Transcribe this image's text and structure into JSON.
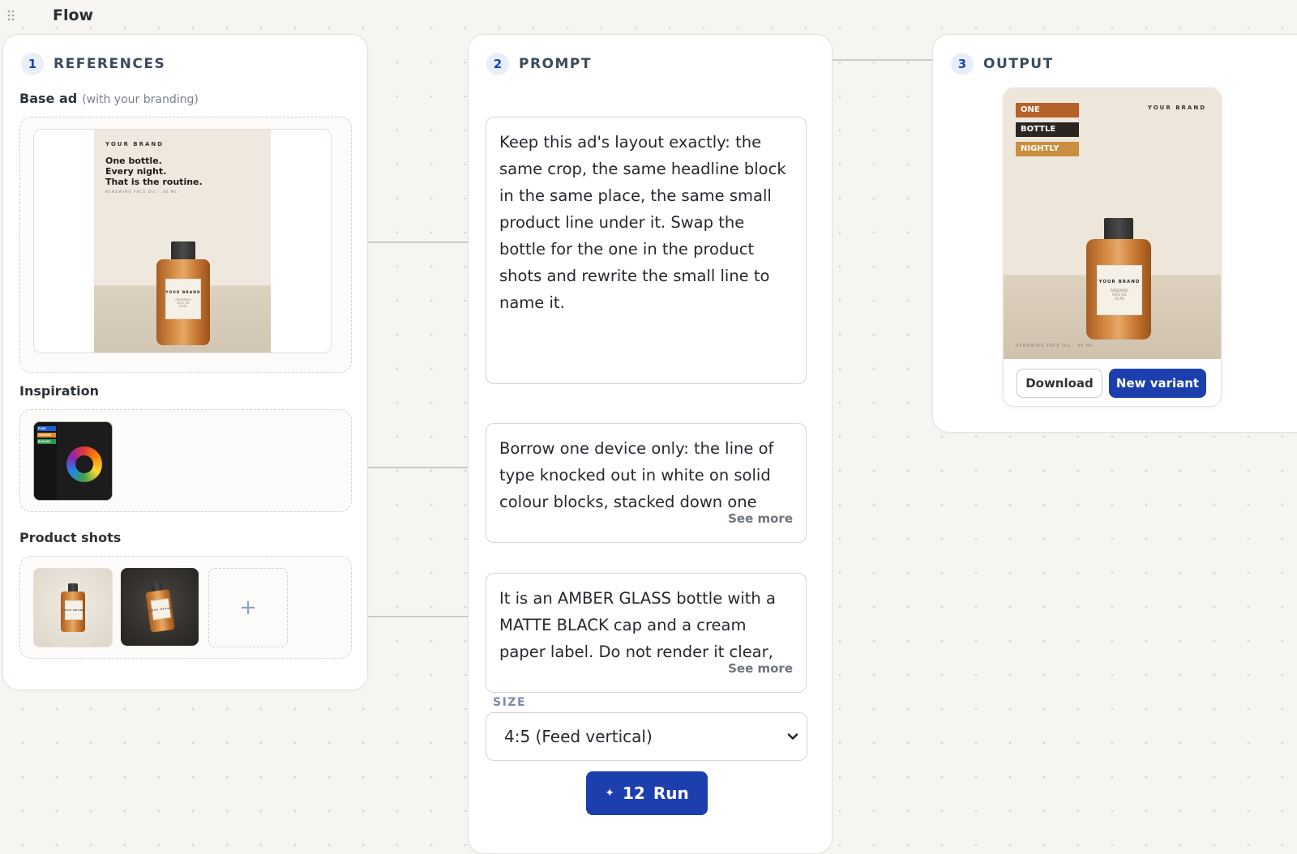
{
  "app": {
    "title": "Flow"
  },
  "references": {
    "step": "1",
    "title": "REFERENCES",
    "base_ad_label": "Base ad",
    "base_ad_hint": "(with your branding)",
    "base_ad": {
      "brand": "YOUR BRAND",
      "headline": [
        "One bottle.",
        "Every night.",
        "That is the routine."
      ],
      "subline": "RENEWING FACE OIL · 30 ML",
      "bottle_label": {
        "brand": "YOUR BRAND",
        "lines": [
          "RENEWING",
          "FACE OIL",
          "30 ML"
        ]
      }
    },
    "inspiration_label": "Inspiration",
    "inspiration_tags": [
      {
        "text": "PLAY",
        "color": "#1e5fd8"
      },
      {
        "text": "COLOUR",
        "color": "#e08a1e"
      },
      {
        "text": "BLOCKS",
        "color": "#2e9a4a"
      }
    ],
    "product_shots_label": "Product shots",
    "product_shot_label": {
      "brand": "YOUR BRAND",
      "lines": [
        "RENEWING",
        "FACE OIL"
      ]
    },
    "add_symbol": "+"
  },
  "prompt": {
    "step": "2",
    "title": "PROMPT",
    "blocks": [
      {
        "text": "Keep this ad's layout exactly: the same crop, the same headline block in the same place, the same small product line under it. Swap the bottle for the one in the product shots and rewrite the small line to name it."
      },
      {
        "text": "Borrow one device only: the line of type knocked out in white on solid colour blocks, stacked down one",
        "more": "See more"
      },
      {
        "text": "It is an AMBER GLASS bottle with a MATTE BLACK cap and a cream paper label. Do not render it clear,",
        "more": "See more"
      }
    ],
    "size_label": "SIZE",
    "size_value": "4:5 (Feed vertical)",
    "run_count": "12",
    "run_label": "Run"
  },
  "output": {
    "step": "3",
    "title": "OUTPUT",
    "ad": {
      "brand": "YOUR BRAND",
      "blocks": [
        {
          "text": "ONE",
          "color": "#b5622a"
        },
        {
          "text": "BOTTLE",
          "color": "#2a2622"
        },
        {
          "text": "NIGHTLY",
          "color": "#c98e3e"
        }
      ],
      "subline": "RENEWING FACE OIL · 30 ML",
      "bottle_label": {
        "brand": "YOUR BRAND",
        "lines": [
          "RENEWING",
          "FACE OIL",
          "30 ML"
        ]
      }
    },
    "download_label": "Download",
    "variant_label": "New variant"
  }
}
